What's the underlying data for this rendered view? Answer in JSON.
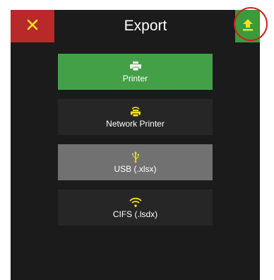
{
  "header": {
    "title": "Export"
  },
  "options": [
    {
      "label": "Printer",
      "icon": "printer-icon"
    },
    {
      "label": "Network Printer",
      "icon": "network-printer-icon"
    },
    {
      "label": "USB (.xlsx)",
      "icon": "usb-icon"
    },
    {
      "label": "CIFS (.lsdx)",
      "icon": "wifi-icon"
    }
  ],
  "colors": {
    "close_bg": "#b9292a",
    "upload_bg": "#3b9a3b",
    "selected_bg": "#43a047",
    "highlighted_bg": "#717171",
    "default_bg": "#262626",
    "panel_bg": "#1b1b1b",
    "icon_yellow": "#f2e21e",
    "annotation_ring": "#d21f1f"
  }
}
